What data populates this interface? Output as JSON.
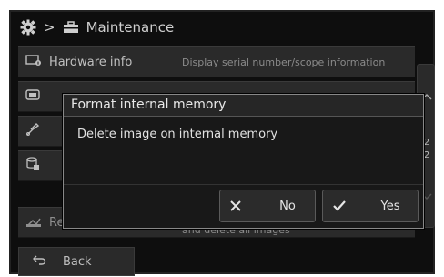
{
  "breadcrumb": {
    "separator": ">",
    "section": "Maintenance"
  },
  "list": {
    "hardware_info": {
      "label": "Hardware info",
      "description": "Display serial number/scope information"
    },
    "reset_all": {
      "label": "Reset all",
      "description": "and delete all images"
    }
  },
  "scroll": {
    "page_current": "2",
    "page_total": "2"
  },
  "back": {
    "label": "Back"
  },
  "dialog": {
    "title": "Format internal memory",
    "message": "Delete image on internal memory",
    "no_label": "No",
    "yes_label": "Yes"
  },
  "colors": {
    "frame_bg": "#0e0e0e",
    "item_bg": "#2a2a2a",
    "dialog_bg": "#181818",
    "text": "#dcdcdc"
  }
}
